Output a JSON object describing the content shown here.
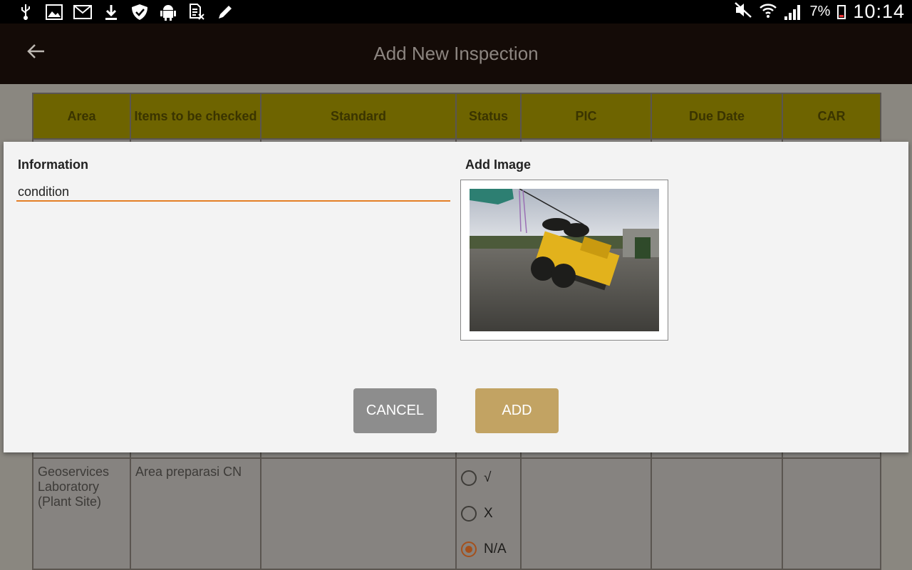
{
  "status_bar": {
    "battery_pct": "7%",
    "time": "10:14",
    "left_icons": [
      "usb-icon",
      "gallery-icon",
      "gmail-icon",
      "download-icon",
      "shield-icon",
      "android-icon",
      "sim-icon",
      "pencil-icon"
    ],
    "right_icons": [
      "mute-icon",
      "wifi-icon",
      "signal-icon",
      "battery-icon"
    ]
  },
  "action_bar": {
    "title": "Add New Inspection"
  },
  "table": {
    "headers": [
      "Area",
      "Items to be checked",
      "Standard",
      "Status",
      "PIC",
      "Due Date",
      "CAR"
    ],
    "row": {
      "area": "Geoservices Laboratory (Plant Site)",
      "item": "Area preparasi CN",
      "standard": "",
      "status_options": [
        {
          "label": "√",
          "selected": false
        },
        {
          "label": "X",
          "selected": false
        },
        {
          "label": "N/A",
          "selected": true
        }
      ]
    }
  },
  "dialog": {
    "info_label": "Information",
    "info_value": "condition",
    "image_label": "Add Image",
    "cancel_label": "CANCEL",
    "add_label": "ADD"
  },
  "colors": {
    "accent_orange": "#e47f26",
    "add_button": "#c2a363",
    "cancel_button": "#8d8d8d",
    "header_bg": "#6e6400",
    "action_bar": "#140b07"
  }
}
